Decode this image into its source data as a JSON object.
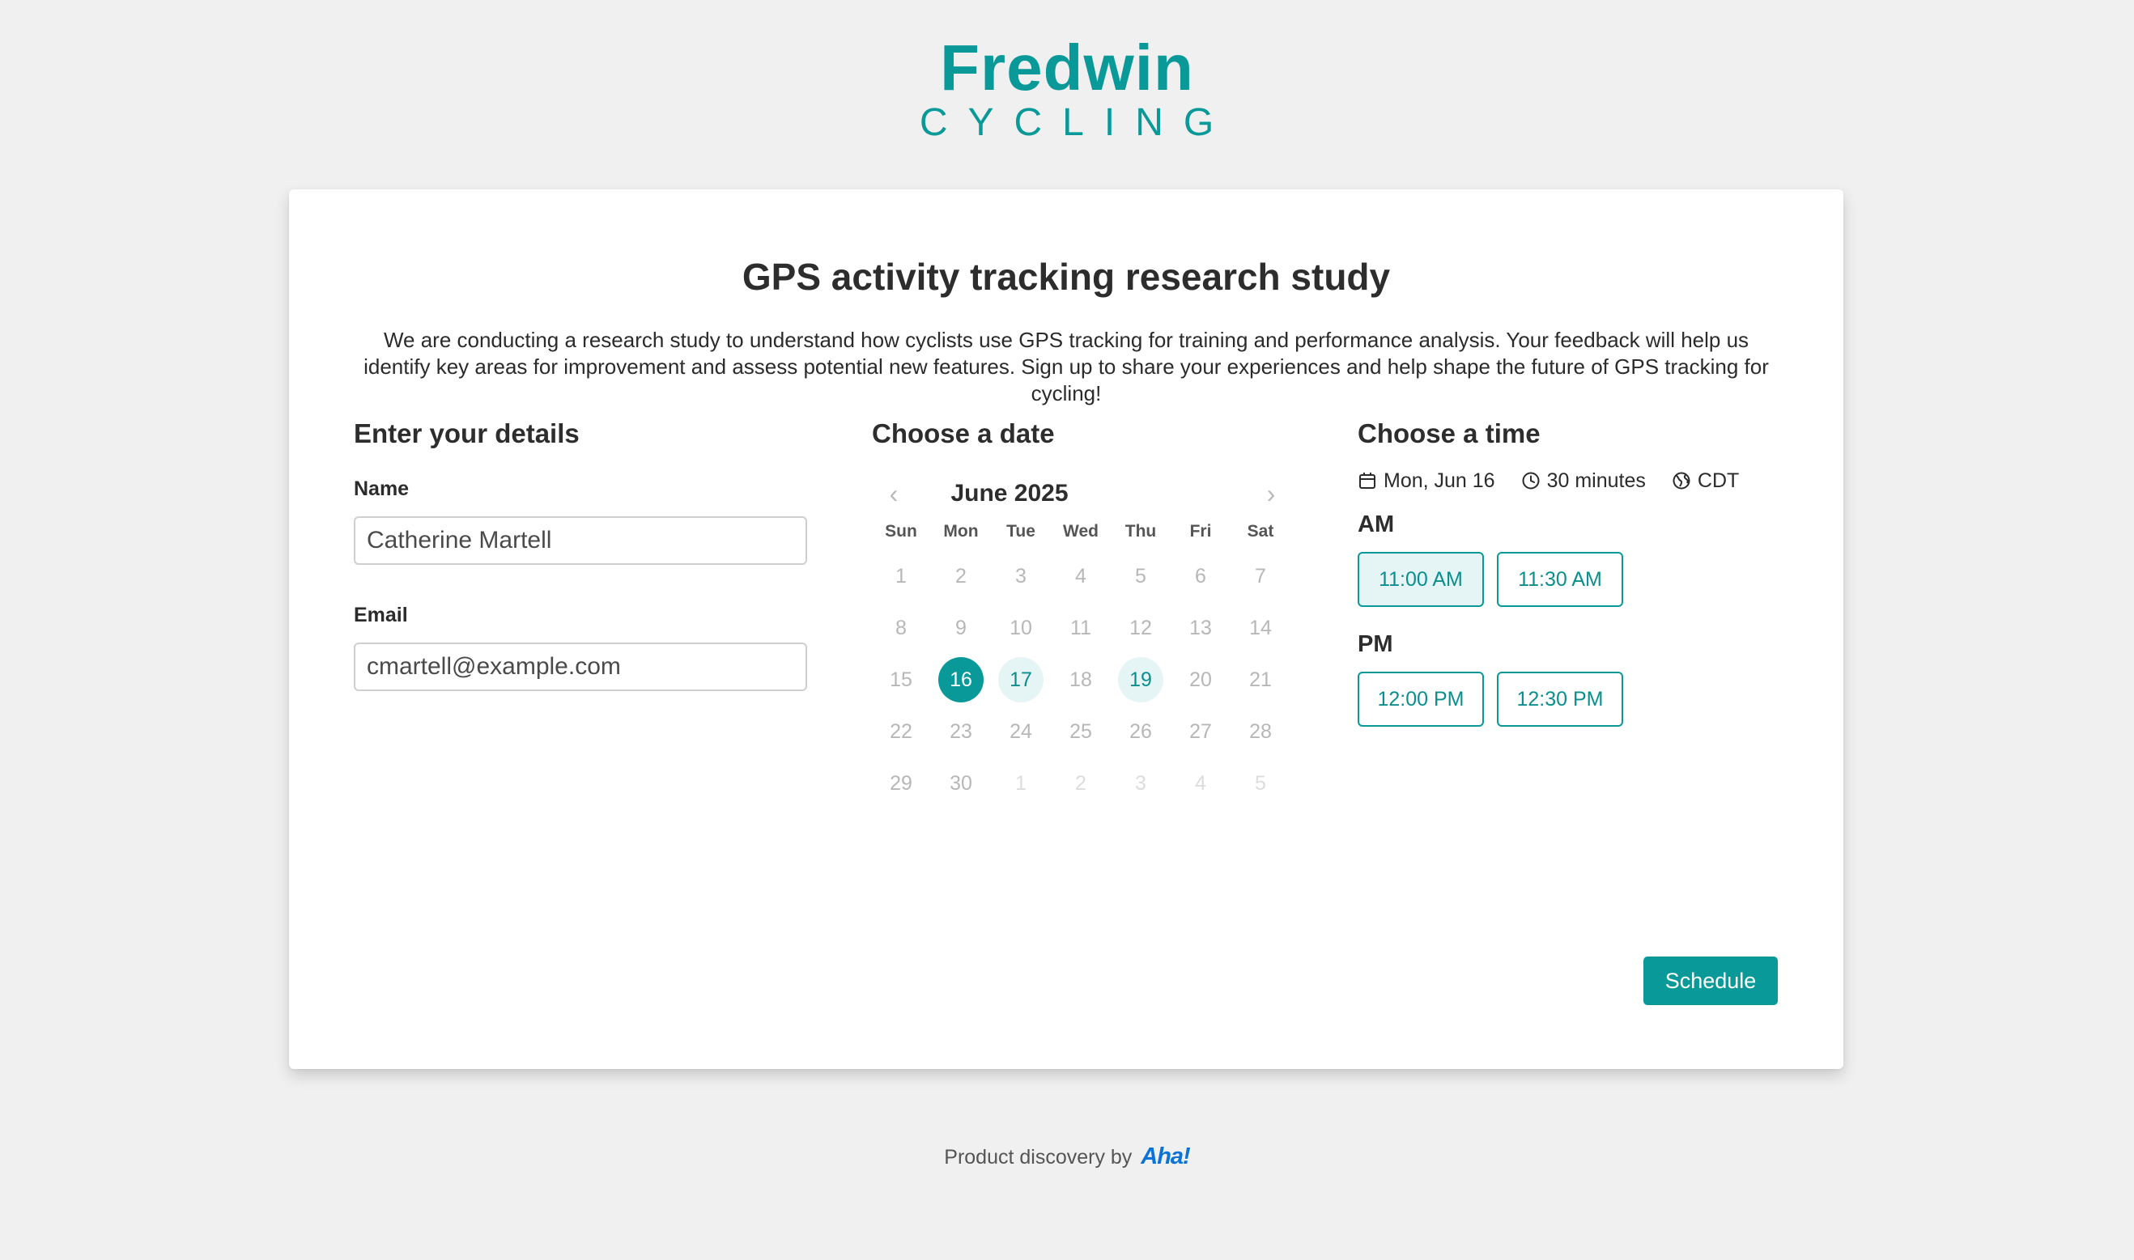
{
  "logo": {
    "word": "Fredwin",
    "sub": "CYCLING",
    "color": "#0a9999"
  },
  "card": {
    "title": "GPS activity tracking research study",
    "description": "We are conducting a research study to understand how cyclists use GPS tracking for training and performance analysis. Your feedback will help us identify key areas for improvement and assess potential new features. Sign up to share your experiences and help shape the future of GPS tracking for cycling!"
  },
  "details": {
    "heading": "Enter your details",
    "name_label": "Name",
    "name_value": "Catherine Martell",
    "email_label": "Email",
    "email_value": "cmartell@example.com"
  },
  "calendar": {
    "heading": "Choose a date",
    "month": "June 2025",
    "prev_icon": "‹",
    "next_icon": "›",
    "weekdays": [
      "Sun",
      "Mon",
      "Tue",
      "Wed",
      "Thu",
      "Fri",
      "Sat"
    ],
    "weeks": [
      [
        {
          "d": "1",
          "s": "unavailable"
        },
        {
          "d": "2",
          "s": "unavailable"
        },
        {
          "d": "3",
          "s": "unavailable"
        },
        {
          "d": "4",
          "s": "unavailable"
        },
        {
          "d": "5",
          "s": "unavailable"
        },
        {
          "d": "6",
          "s": "unavailable"
        },
        {
          "d": "7",
          "s": "unavailable"
        }
      ],
      [
        {
          "d": "8",
          "s": "unavailable"
        },
        {
          "d": "9",
          "s": "unavailable"
        },
        {
          "d": "10",
          "s": "unavailable"
        },
        {
          "d": "11",
          "s": "unavailable"
        },
        {
          "d": "12",
          "s": "unavailable"
        },
        {
          "d": "13",
          "s": "unavailable"
        },
        {
          "d": "14",
          "s": "unavailable"
        }
      ],
      [
        {
          "d": "15",
          "s": "unavailable"
        },
        {
          "d": "16",
          "s": "selected"
        },
        {
          "d": "17",
          "s": "available"
        },
        {
          "d": "18",
          "s": "unavailable"
        },
        {
          "d": "19",
          "s": "available"
        },
        {
          "d": "20",
          "s": "unavailable"
        },
        {
          "d": "21",
          "s": "unavailable"
        }
      ],
      [
        {
          "d": "22",
          "s": "unavailable"
        },
        {
          "d": "23",
          "s": "unavailable"
        },
        {
          "d": "24",
          "s": "unavailable"
        },
        {
          "d": "25",
          "s": "unavailable"
        },
        {
          "d": "26",
          "s": "unavailable"
        },
        {
          "d": "27",
          "s": "unavailable"
        },
        {
          "d": "28",
          "s": "unavailable"
        }
      ],
      [
        {
          "d": "29",
          "s": "unavailable"
        },
        {
          "d": "30",
          "s": "unavailable"
        },
        {
          "d": "1",
          "s": "outside"
        },
        {
          "d": "2",
          "s": "outside"
        },
        {
          "d": "3",
          "s": "outside"
        },
        {
          "d": "4",
          "s": "outside"
        },
        {
          "d": "5",
          "s": "outside"
        }
      ]
    ]
  },
  "time": {
    "heading": "Choose a time",
    "date_text": "Mon, Jun 16",
    "duration_text": "30 minutes",
    "timezone_text": "CDT",
    "am_label": "AM",
    "pm_label": "PM",
    "am_slots": [
      {
        "label": "11:00 AM",
        "active": true
      },
      {
        "label": "11:30 AM",
        "active": false
      }
    ],
    "pm_slots": [
      {
        "label": "12:00 PM",
        "active": false
      },
      {
        "label": "12:30 PM",
        "active": false
      }
    ]
  },
  "schedule_label": "Schedule",
  "footer": {
    "text": "Product discovery by",
    "brand": "Aha!"
  },
  "colors": {
    "accent": "#0a9999",
    "accent_light": "#e5f4f4",
    "brand_blue": "#0b72d6"
  }
}
